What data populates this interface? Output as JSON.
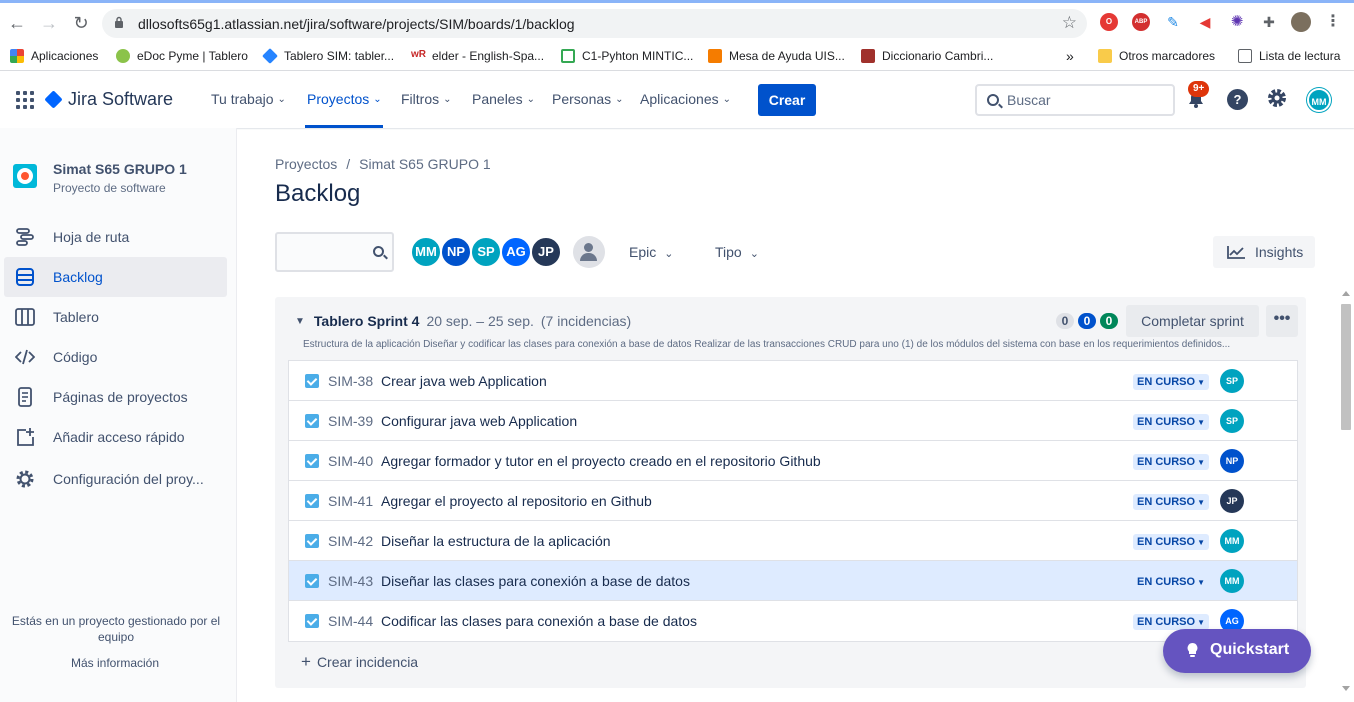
{
  "browser": {
    "url": "dllosofts65g1.atlassian.net/jira/software/projects/SIM/boards/1/backlog",
    "notif_badge": "ABP",
    "bookmarks": [
      {
        "label": "Aplicaciones",
        "color": "#EA4335"
      },
      {
        "label": "eDoc Pyme | Tablero",
        "color": "#8BC34A"
      },
      {
        "label": "Tablero SIM: tabler...",
        "color": "#2684FF"
      },
      {
        "label": "elder - English-Spa...",
        "color": "#F4B400"
      },
      {
        "label": "C1-Pyhton MINTIC...",
        "color": "#34A853"
      },
      {
        "label": "Mesa de Ayuda UIS...",
        "color": "#F57C00"
      },
      {
        "label": "Diccionario Cambri...",
        "color": "#A0312C"
      }
    ],
    "overflow": "»",
    "other_bookmarks": "Otros marcadores",
    "reading_list": "Lista de lectura"
  },
  "topnav": {
    "product": "Jira Software",
    "items": [
      {
        "label": "Tu trabajo"
      },
      {
        "label": "Proyectos"
      },
      {
        "label": "Filtros"
      },
      {
        "label": "Paneles"
      },
      {
        "label": "Personas"
      },
      {
        "label": "Aplicaciones"
      }
    ],
    "create": "Crear",
    "search_placeholder": "Buscar",
    "notifications": "9+",
    "help": "?",
    "user_initials": "MM"
  },
  "sidebar": {
    "project_name": "Simat S65 GRUPO 1",
    "project_type": "Proyecto de software",
    "items": [
      {
        "label": "Hoja de ruta",
        "icon": "roadmap-icon"
      },
      {
        "label": "Backlog",
        "icon": "backlog-icon"
      },
      {
        "label": "Tablero",
        "icon": "board-icon"
      },
      {
        "label": "Código",
        "icon": "code-icon"
      },
      {
        "label": "Páginas de proyectos",
        "icon": "pages-icon"
      },
      {
        "label": "Añadir acceso rápido",
        "icon": "add-shortcut-icon"
      },
      {
        "label": "Configuración del proy...",
        "icon": "gear-icon"
      }
    ],
    "footer_text": "Estás en un proyecto gestionado por el equipo",
    "more_info": "Más información"
  },
  "main": {
    "breadcrumb": [
      "Proyectos",
      "Simat S65 GRUPO 1"
    ],
    "breadcrumb_sep": "/",
    "title": "Backlog",
    "people": [
      {
        "initials": "MM",
        "color": "#00A3BF"
      },
      {
        "initials": "NP",
        "color": "#0052CC"
      },
      {
        "initials": "SP",
        "color": "#00A3BF"
      },
      {
        "initials": "AG",
        "color": "#0065FF"
      },
      {
        "initials": "JP",
        "color": "#253858"
      }
    ],
    "filters": [
      "Epic",
      "Tipo"
    ],
    "insights": "Insights"
  },
  "sprint": {
    "name": "Tablero Sprint 4",
    "dates": "20 sep. – 25 sep.",
    "count": "(7 incidencias)",
    "points": [
      {
        "value": "0",
        "bg": "#DFE1E6",
        "fg": "#42526E"
      },
      {
        "value": "0",
        "bg": "#0052CC",
        "fg": "#FFFFFF"
      },
      {
        "value": "0",
        "bg": "#00875A",
        "fg": "#FFFFFF"
      }
    ],
    "complete_label": "Completar sprint",
    "more_label": "•••",
    "goal": "Estructura de la aplicación Diseñar y codificar las clases para conexión a base de datos Realizar de las transacciones CRUD para uno (1) de los módulos del sistema con base en los requerimientos definidos...",
    "issues": [
      {
        "key": "SIM-38",
        "summary": "Crear java web Application",
        "status": "EN CURSO",
        "assignee": "SP",
        "color": "#00A3BF"
      },
      {
        "key": "SIM-39",
        "summary": "Configurar java web Application",
        "status": "EN CURSO",
        "assignee": "SP",
        "color": "#00A3BF"
      },
      {
        "key": "SIM-40",
        "summary": "Agregar formador y tutor en el proyecto creado en el repositorio Github",
        "status": "EN CURSO",
        "assignee": "NP",
        "color": "#0052CC"
      },
      {
        "key": "SIM-41",
        "summary": "Agregar el proyecto al repositorio en Github",
        "status": "EN CURSO",
        "assignee": "JP",
        "color": "#253858"
      },
      {
        "key": "SIM-42",
        "summary": "Diseñar la estructura de la aplicación",
        "status": "EN CURSO",
        "assignee": "MM",
        "color": "#00A3BF"
      },
      {
        "key": "SIM-43",
        "summary": "Diseñar las clases para conexión a base de datos",
        "status": "EN CURSO",
        "assignee": "MM",
        "color": "#00A3BF"
      },
      {
        "key": "SIM-44",
        "summary": "Codificar las clases para conexión a base de datos",
        "status": "EN CURSO",
        "assignee": "AG",
        "color": "#0065FF"
      }
    ],
    "create_issue": "Crear incidencia"
  },
  "quickstart": "Quickstart"
}
